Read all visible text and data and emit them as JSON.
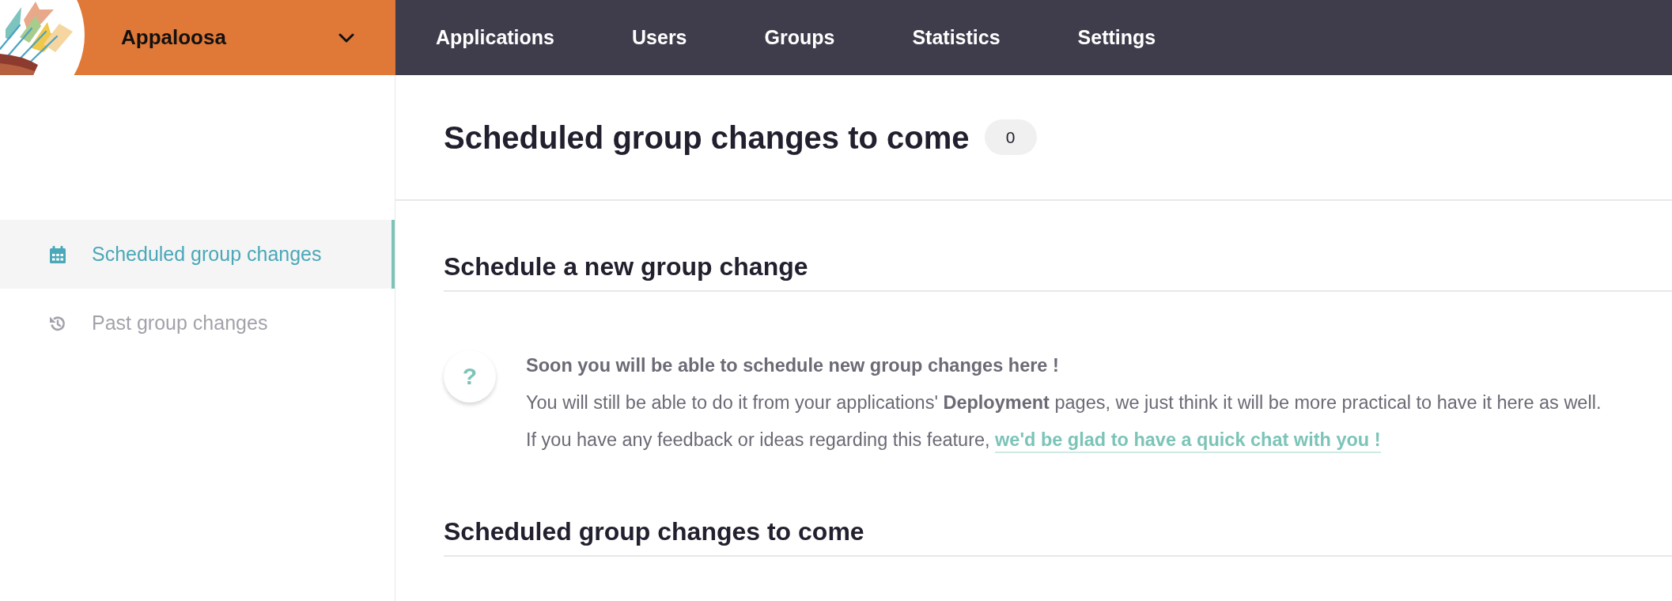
{
  "org_switcher": {
    "name": "Appaloosa"
  },
  "nav": [
    {
      "label": "Applications",
      "selected": false
    },
    {
      "label": "Users",
      "selected": false
    },
    {
      "label": "Groups",
      "selected": false
    },
    {
      "label": "Statistics",
      "selected": false
    },
    {
      "label": "Settings",
      "selected": false
    }
  ],
  "sidebar": {
    "items": [
      {
        "label": "Scheduled group changes",
        "selected": true
      },
      {
        "label": "Past group changes",
        "selected": false
      }
    ]
  },
  "header": {
    "title": "Scheduled group changes to come",
    "count": "0"
  },
  "sections": [
    {
      "heading": "Schedule a new group change",
      "notice": {
        "icon": "?",
        "title": "Soon you will be able to schedule new group changes here !",
        "text": "You will still be able to do it from your applications' **Deployment** pages, we just think it will be more practical to have it here as well.",
        "feedback": {
          "text": "If you have any feedback or ideas regarding this feature,",
          "link": "we'd be glad to have a quick chat with you !"
        }
      }
    },
    {
      "heading": "Scheduled group changes to come"
    }
  ]
}
